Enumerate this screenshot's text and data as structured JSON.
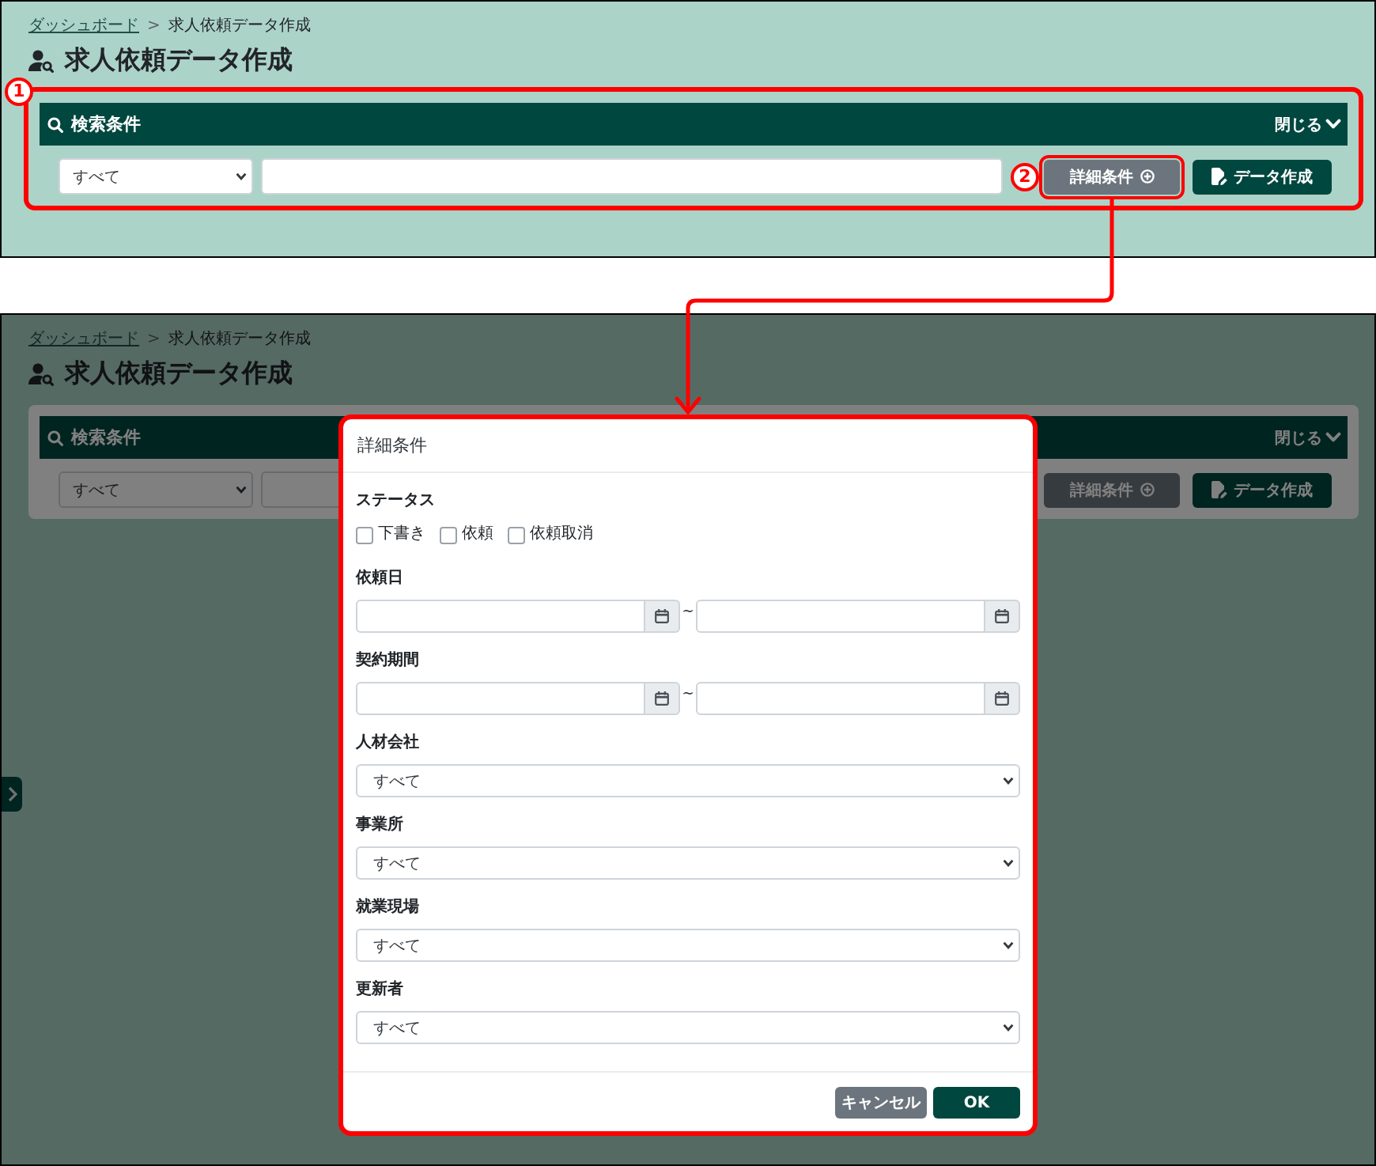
{
  "screens": [
    {
      "breadcrumb": {
        "items": [
          {
            "label": "ダッシュボード",
            "link": true
          },
          {
            "label": "求人依頼データ作成",
            "link": false
          }
        ],
        "separator": ">"
      },
      "title": "求人依頼データ作成",
      "search_panel": {
        "marker": "1",
        "title": "検索条件",
        "toggle": "閉じる",
        "filter_select": {
          "value": "すべて"
        },
        "buttons": [
          {
            "kind": "details",
            "label": "詳細条件",
            "marker": "2"
          },
          {
            "kind": "create",
            "label": "データ作成"
          }
        ]
      }
    },
    {
      "breadcrumb": {
        "items": [
          {
            "label": "ダッシュボード",
            "link": true
          },
          {
            "label": "求人依頼データ作成",
            "link": false
          }
        ],
        "separator": ">"
      },
      "title": "求人依頼データ作成",
      "search_panel": {
        "title": "検索条件",
        "toggle": "閉じる",
        "filter_select": {
          "value": "すべて"
        },
        "buttons": [
          {
            "kind": "details",
            "label": "詳細条件"
          },
          {
            "kind": "create",
            "label": "データ作成"
          }
        ]
      },
      "side_toggle": {
        "expanded": false
      },
      "dialog": {
        "highlighted": true,
        "title": "詳細条件",
        "fields": [
          {
            "kind": "checkboxes",
            "label": "ステータス",
            "options": [
              {
                "label": "下書き",
                "checked": false
              },
              {
                "label": "依頼",
                "checked": false
              },
              {
                "label": "依頼取消",
                "checked": false
              }
            ]
          },
          {
            "kind": "date_range",
            "label": "依頼日",
            "separator": "~"
          },
          {
            "kind": "date_range",
            "label": "契約期間",
            "separator": "~"
          },
          {
            "kind": "select",
            "label": "人材会社",
            "value": "すべて"
          },
          {
            "kind": "select",
            "label": "事業所",
            "value": "すべて"
          },
          {
            "kind": "select",
            "label": "就業現場",
            "value": "すべて"
          },
          {
            "kind": "select",
            "label": "更新者",
            "value": "すべて"
          }
        ],
        "buttons": [
          {
            "kind": "cancel",
            "label": "キャンセル"
          },
          {
            "kind": "ok",
            "label": "OK"
          }
        ]
      }
    }
  ]
}
